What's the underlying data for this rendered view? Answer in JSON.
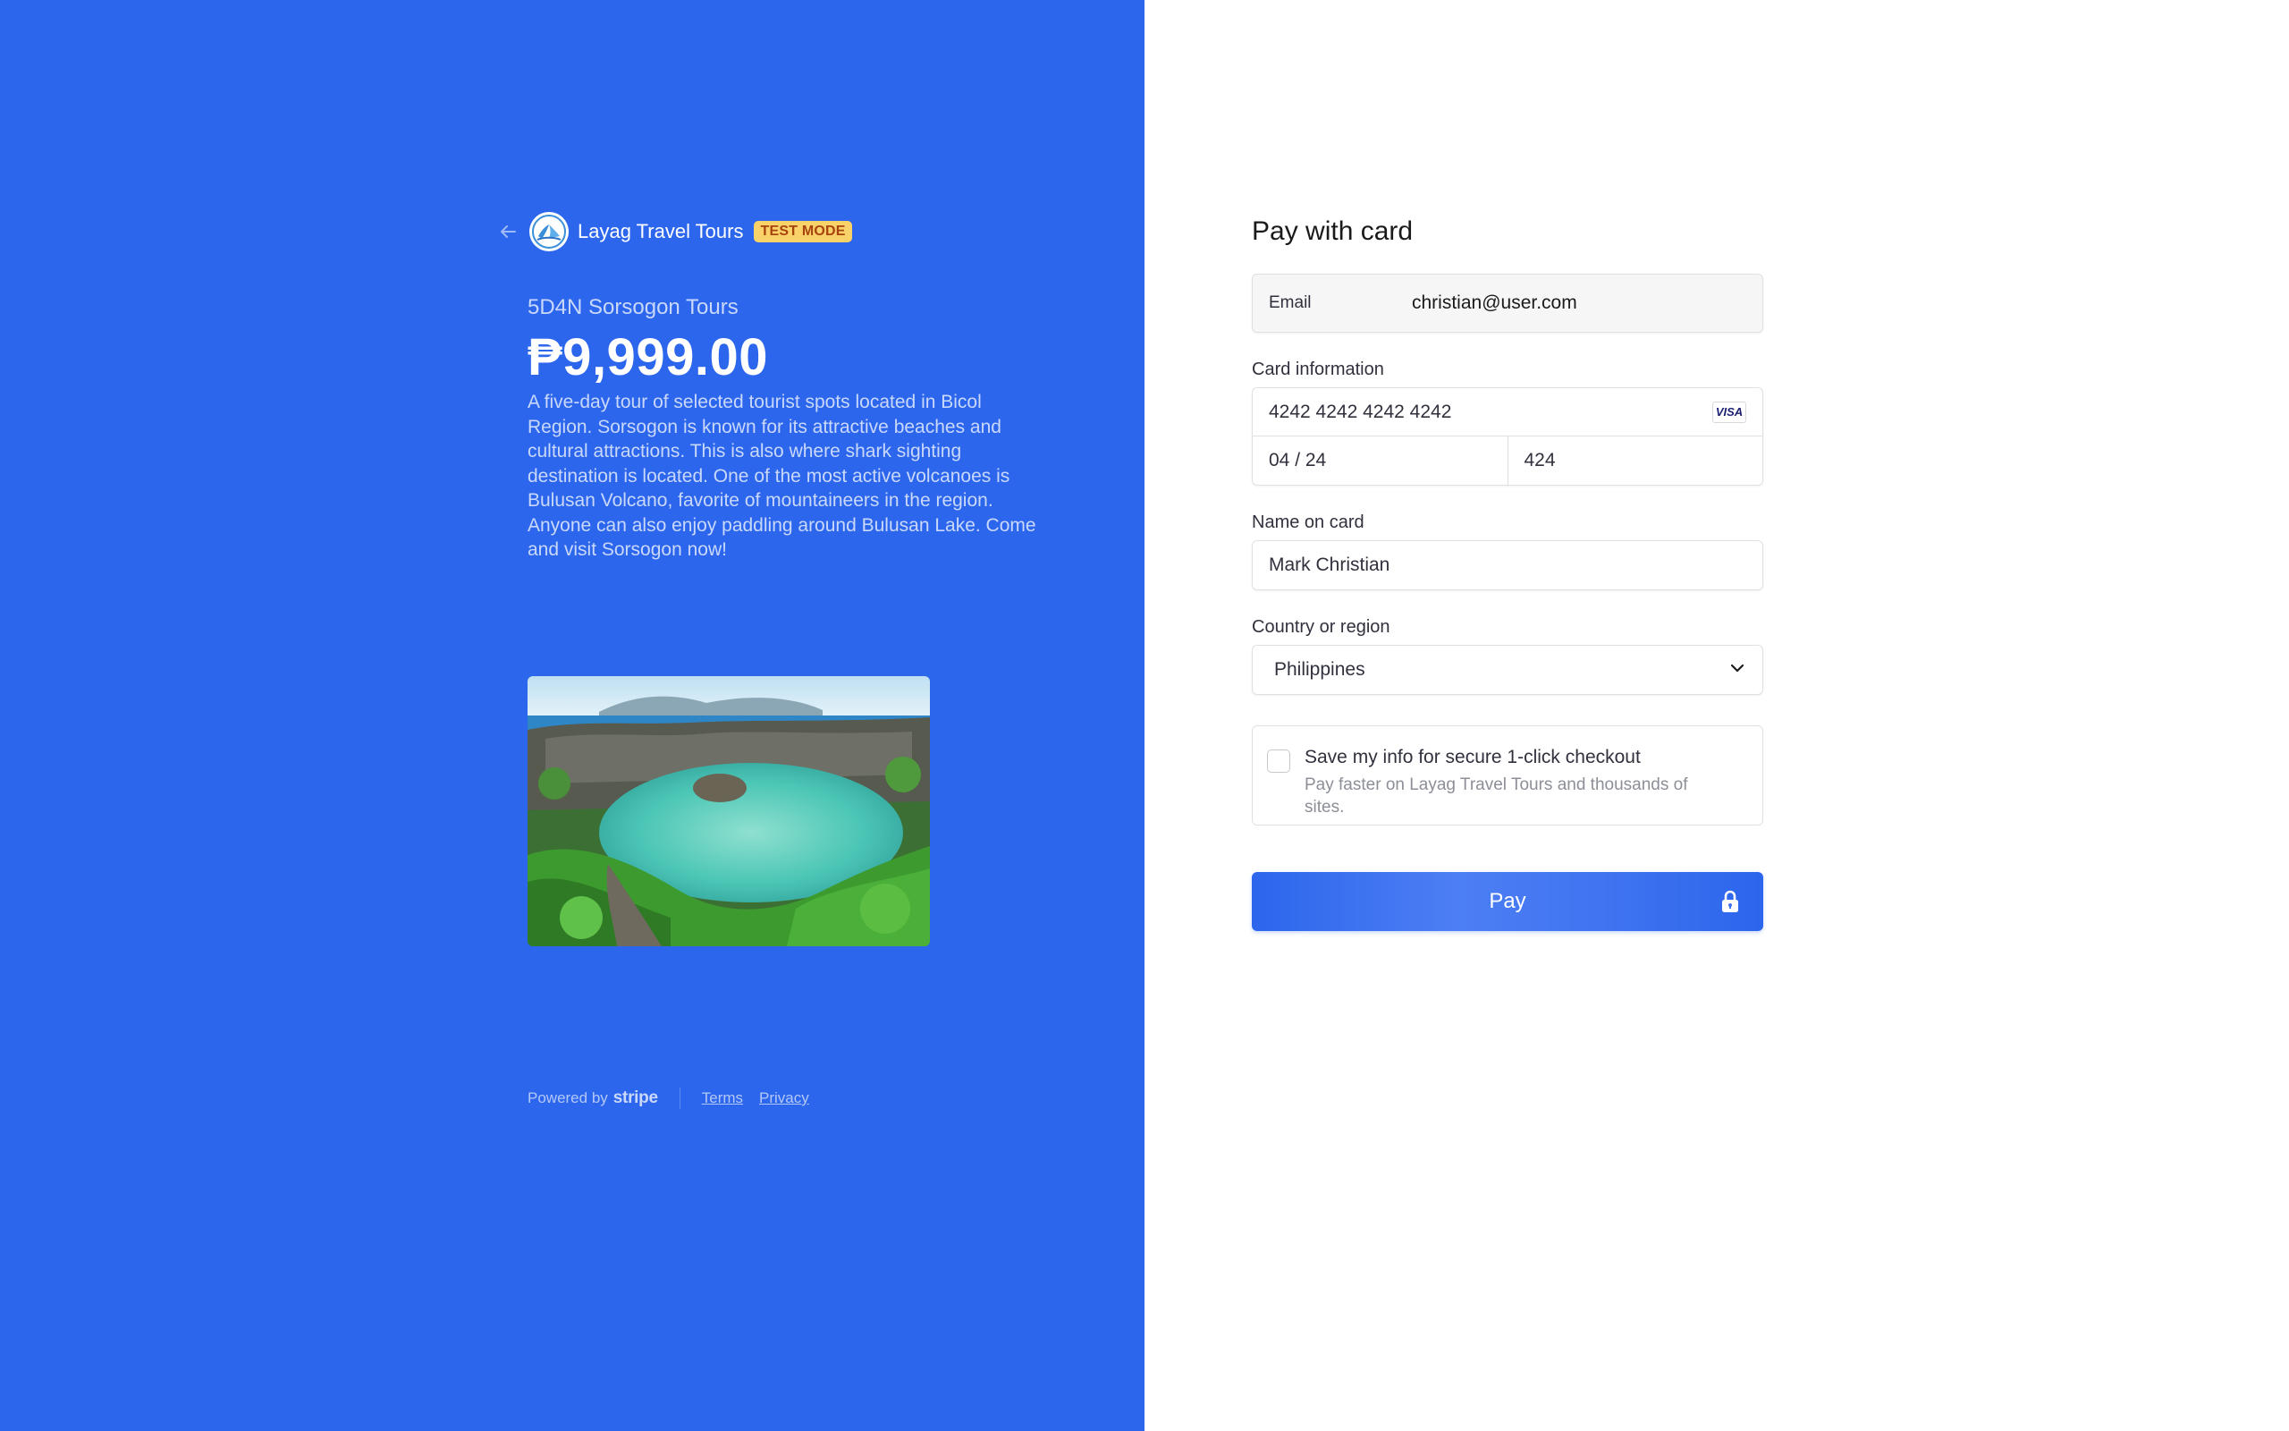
{
  "merchant": {
    "name": "Layag Travel Tours",
    "badge": "TEST MODE"
  },
  "product": {
    "name": "5D4N Sorsogon Tours",
    "price": "₱9,999.00",
    "description": "A five-day tour of selected tourist spots located in Bicol Region. Sorsogon is known for its attractive beaches and cultural attractions. This is also where shark sighting destination is located. One of the most active volcanoes is Bulusan Volcano, favorite of mountaineers in the region. Anyone can also enjoy paddling around Bulusan Lake. Come and visit Sorsogon now!"
  },
  "footer": {
    "powered_by": "Powered by",
    "brand": "stripe",
    "terms": "Terms",
    "privacy": "Privacy"
  },
  "form": {
    "title": "Pay with card",
    "email_label": "Email",
    "email_value": "christian@user.com",
    "card_label": "Card information",
    "card_number": "4242 4242 4242 4242",
    "card_brand": "VISA",
    "card_expiry": "04 / 24",
    "card_cvc": "424",
    "name_label": "Name on card",
    "name_value": "Mark Christian",
    "country_label": "Country or region",
    "country_value": "Philippines",
    "save_title": "Save my info for secure 1-click checkout",
    "save_subtitle": "Pay faster on Layag Travel Tours and thousands of sites.",
    "pay_label": "Pay"
  },
  "colors": {
    "brand_blue": "#2c66ec",
    "test_badge_bg": "#f9d26a",
    "test_badge_text": "#a8430e"
  },
  "icons": [
    "back-arrow-icon",
    "merchant-logo-icon",
    "visa-icon",
    "chevron-down-icon",
    "lock-icon"
  ]
}
